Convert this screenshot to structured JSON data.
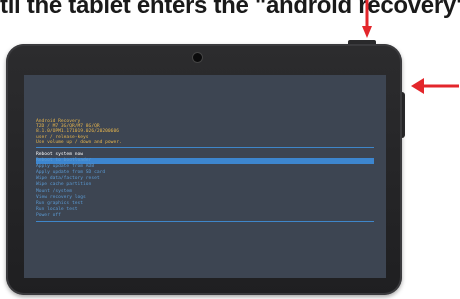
{
  "caption": "til the tablet enters the \"android recovery\"",
  "recovery": {
    "header_lines": [
      "Android Recovery",
      "T2D / M7 3G/QR/M7 8G/QR",
      "8.1.0/OPM1.171019.026/20200606",
      "user / release-keys",
      "Use volume up / down and power."
    ],
    "menu": [
      "Reboot system now",
      "Reboot to bootloader",
      "Apply update from ADB",
      "Apply update from SD card",
      "Wipe data/factory reset",
      "Wipe cache partition",
      "Mount /system",
      "View recovery logs",
      "Run graphics test",
      "Run locale test",
      "Power off"
    ],
    "selected_index": 0
  },
  "colors": {
    "header_text": "#e8b64c",
    "menu_text": "#5b9bd5",
    "highlight": "#3d86cf",
    "arrow": "#e3262b"
  },
  "icons": [
    "camera-icon",
    "arrow-down-icon",
    "arrow-left-icon"
  ]
}
